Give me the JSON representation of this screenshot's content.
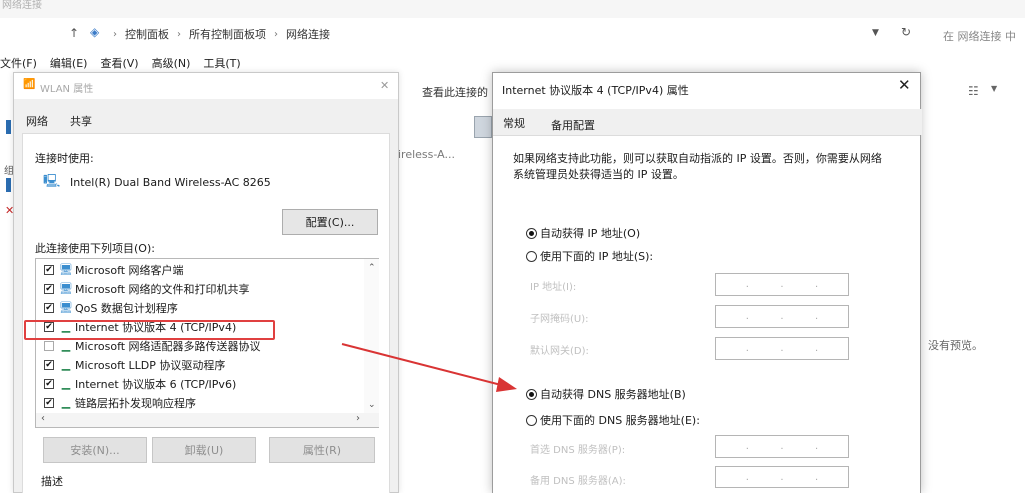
{
  "window": {
    "title": "网络连接",
    "minimize": "—"
  },
  "address": {
    "crumbs": [
      "控制面板",
      "所有控制面板项",
      "网络连接"
    ],
    "search_placeholder": "在 网络连接 中"
  },
  "menu": [
    "文件(F)",
    "编辑(E)",
    "查看(V)",
    "高级(N)",
    "工具(T)"
  ],
  "commands": {
    "view_status": "查看此连接的"
  },
  "background": {
    "adapter_label": "ireless-A...",
    "no_preview": "没有预览。",
    "left_edge": "组"
  },
  "wlan_dialog": {
    "title": "WLAN 属性",
    "tabs": [
      "网络",
      "共享"
    ],
    "connect_using_label": "连接时使用:",
    "adapter_name": "Intel(R) Dual Band Wireless-AC 8265",
    "configure_button": "配置(C)...",
    "items_label": "此连接使用下列项目(O):",
    "items": [
      {
        "label": "Microsoft 网络客户端",
        "checked": true
      },
      {
        "label": "Microsoft 网络的文件和打印机共享",
        "checked": true
      },
      {
        "label": "QoS 数据包计划程序",
        "checked": true
      },
      {
        "label": "Internet 协议版本 4 (TCP/IPv4)",
        "checked": true
      },
      {
        "label": "Microsoft 网络适配器多路传送器协议",
        "checked": false
      },
      {
        "label": "Microsoft LLDP 协议驱动程序",
        "checked": true
      },
      {
        "label": "Internet 协议版本 6 (TCP/IPv6)",
        "checked": true
      },
      {
        "label": "链路层拓扑发现响应程序",
        "checked": true
      }
    ],
    "buttons": [
      "安装(N)...",
      "卸载(U)",
      "属性(R)"
    ],
    "description_label": "描述"
  },
  "ipv4_dialog": {
    "title": "Internet 协议版本 4 (TCP/IPv4) 属性",
    "tabs": [
      "常规",
      "备用配置"
    ],
    "info_text": "如果网络支持此功能，则可以获取自动指派的 IP 设置。否则，你需要从网络系统管理员处获得适当的 IP 设置。",
    "auto_ip_label": "自动获得 IP 地址(O)",
    "manual_ip_label": "使用下面的 IP 地址(S):",
    "ip_fields": [
      "IP 地址(I):",
      "子网掩码(U):",
      "默认网关(D):"
    ],
    "auto_dns_label": "自动获得 DNS 服务器地址(B)",
    "manual_dns_label": "使用下面的 DNS 服务器地址(E):",
    "dns_fields": [
      "首选 DNS 服务器(P):",
      "备用 DNS 服务器(A):"
    ],
    "ip_selected": "auto",
    "dns_selected": "auto"
  },
  "colors": {
    "highlight": "#e04040",
    "arrow": "#d93434"
  }
}
